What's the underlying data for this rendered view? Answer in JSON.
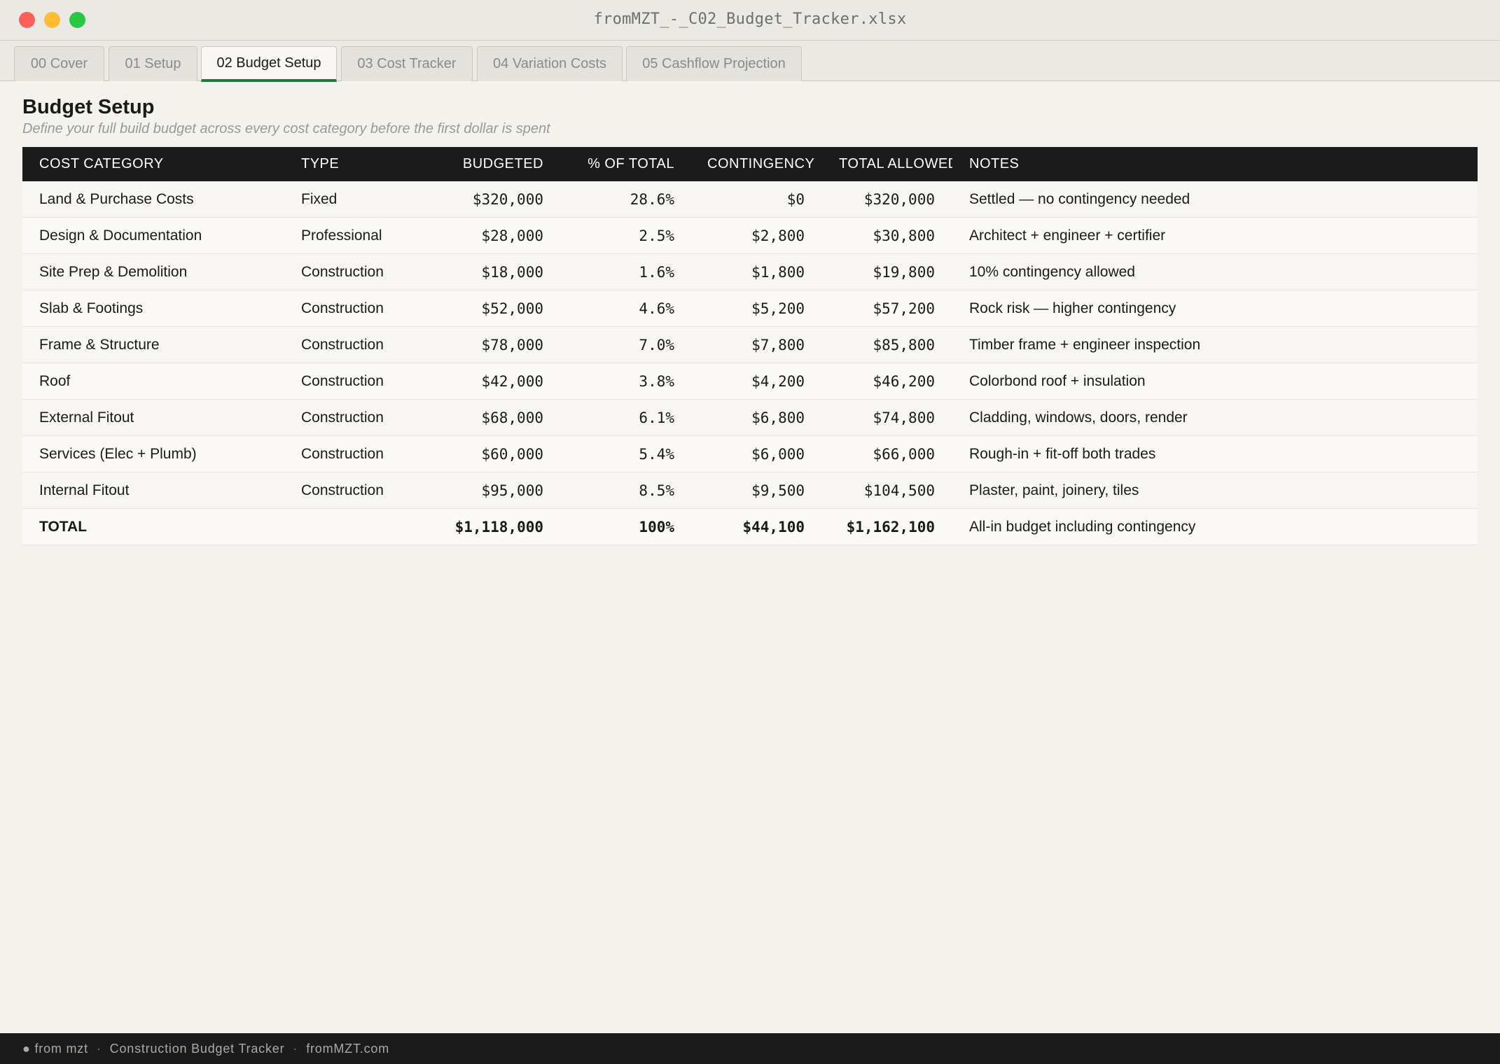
{
  "window": {
    "title": "fromMZT_-_C02_Budget_Tracker.xlsx"
  },
  "tabs": [
    {
      "label": "00 Cover"
    },
    {
      "label": "01 Setup"
    },
    {
      "label": "02 Budget Setup",
      "active": true
    },
    {
      "label": "03 Cost Tracker"
    },
    {
      "label": "04 Variation Costs"
    },
    {
      "label": "05 Cashflow Projection"
    }
  ],
  "page": {
    "title": "Budget Setup",
    "subtitle": "Define your full build budget across every cost category before the first dollar is spent"
  },
  "table": {
    "headers": {
      "category": "COST CATEGORY",
      "type": "TYPE",
      "budgeted": "BUDGETED",
      "pct": "% OF TOTAL",
      "contingency": "CONTINGENCY",
      "total": "TOTAL ALLOWED",
      "notes": "NOTES"
    },
    "rows": [
      {
        "category": "Land & Purchase Costs",
        "type": "Fixed",
        "budgeted": "$320,000",
        "pct": "28.6%",
        "contingency": "$0",
        "total": "$320,000",
        "notes": "Settled — no contingency needed"
      },
      {
        "category": "Design & Documentation",
        "type": "Professional",
        "budgeted": "$28,000",
        "pct": "2.5%",
        "contingency": "$2,800",
        "total": "$30,800",
        "notes": "Architect + engineer + certifier"
      },
      {
        "category": "Site Prep & Demolition",
        "type": "Construction",
        "budgeted": "$18,000",
        "pct": "1.6%",
        "contingency": "$1,800",
        "total": "$19,800",
        "notes": "10% contingency allowed"
      },
      {
        "category": "Slab & Footings",
        "type": "Construction",
        "budgeted": "$52,000",
        "pct": "4.6%",
        "contingency": "$5,200",
        "total": "$57,200",
        "notes": "Rock risk — higher contingency"
      },
      {
        "category": "Frame & Structure",
        "type": "Construction",
        "budgeted": "$78,000",
        "pct": "7.0%",
        "contingency": "$7,800",
        "total": "$85,800",
        "notes": "Timber frame + engineer inspection"
      },
      {
        "category": "Roof",
        "type": "Construction",
        "budgeted": "$42,000",
        "pct": "3.8%",
        "contingency": "$4,200",
        "total": "$46,200",
        "notes": "Colorbond roof + insulation"
      },
      {
        "category": "External Fitout",
        "type": "Construction",
        "budgeted": "$68,000",
        "pct": "6.1%",
        "contingency": "$6,800",
        "total": "$74,800",
        "notes": "Cladding, windows, doors, render"
      },
      {
        "category": "Services (Elec + Plumb)",
        "type": "Construction",
        "budgeted": "$60,000",
        "pct": "5.4%",
        "contingency": "$6,000",
        "total": "$66,000",
        "notes": "Rough-in + fit-off both trades"
      },
      {
        "category": "Internal Fitout",
        "type": "Construction",
        "budgeted": "$95,000",
        "pct": "8.5%",
        "contingency": "$9,500",
        "total": "$104,500",
        "notes": "Plaster, paint, joinery, tiles"
      }
    ],
    "total_row": {
      "category": "TOTAL",
      "type": "",
      "budgeted": "$1,118,000",
      "pct": "100%",
      "contingency": "$44,100",
      "total": "$1,162,100",
      "notes": "All-in budget including contingency"
    }
  },
  "footer": {
    "brand": "● from mzt",
    "product": "Construction Budget Tracker",
    "site": "fromMZT.com"
  },
  "colors": {
    "active_tab_accent": "#1e7a3a",
    "header_bg": "#1b1b1b",
    "page_bg": "#f4f2ec"
  }
}
